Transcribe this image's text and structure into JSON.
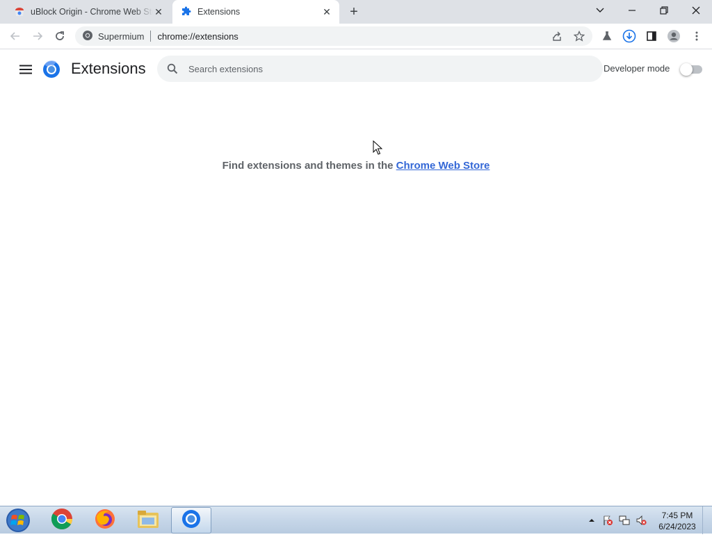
{
  "tabs": [
    {
      "title": "uBlock Origin - Chrome Web Store",
      "active": false
    },
    {
      "title": "Extensions",
      "active": true
    }
  ],
  "window": {
    "new_tab": "+"
  },
  "omnibox": {
    "site_label": "Supermium",
    "url": "chrome://extensions"
  },
  "page": {
    "title": "Extensions",
    "search_placeholder": "Search extensions",
    "developer_mode_label": "Developer mode",
    "developer_mode_on": false,
    "empty_text": "Find extensions and themes in the ",
    "store_link": "Chrome Web Store"
  },
  "taskbar": {
    "apps": [
      "chrome-icon",
      "firefox-icon",
      "file-explorer-icon",
      "supermium-icon"
    ],
    "time": "7:45 PM",
    "date": "6/24/2023"
  },
  "colors": {
    "tabstrip": "#dee1e6",
    "accent": "#1a73e8",
    "omnibox": "#f1f3f4"
  }
}
